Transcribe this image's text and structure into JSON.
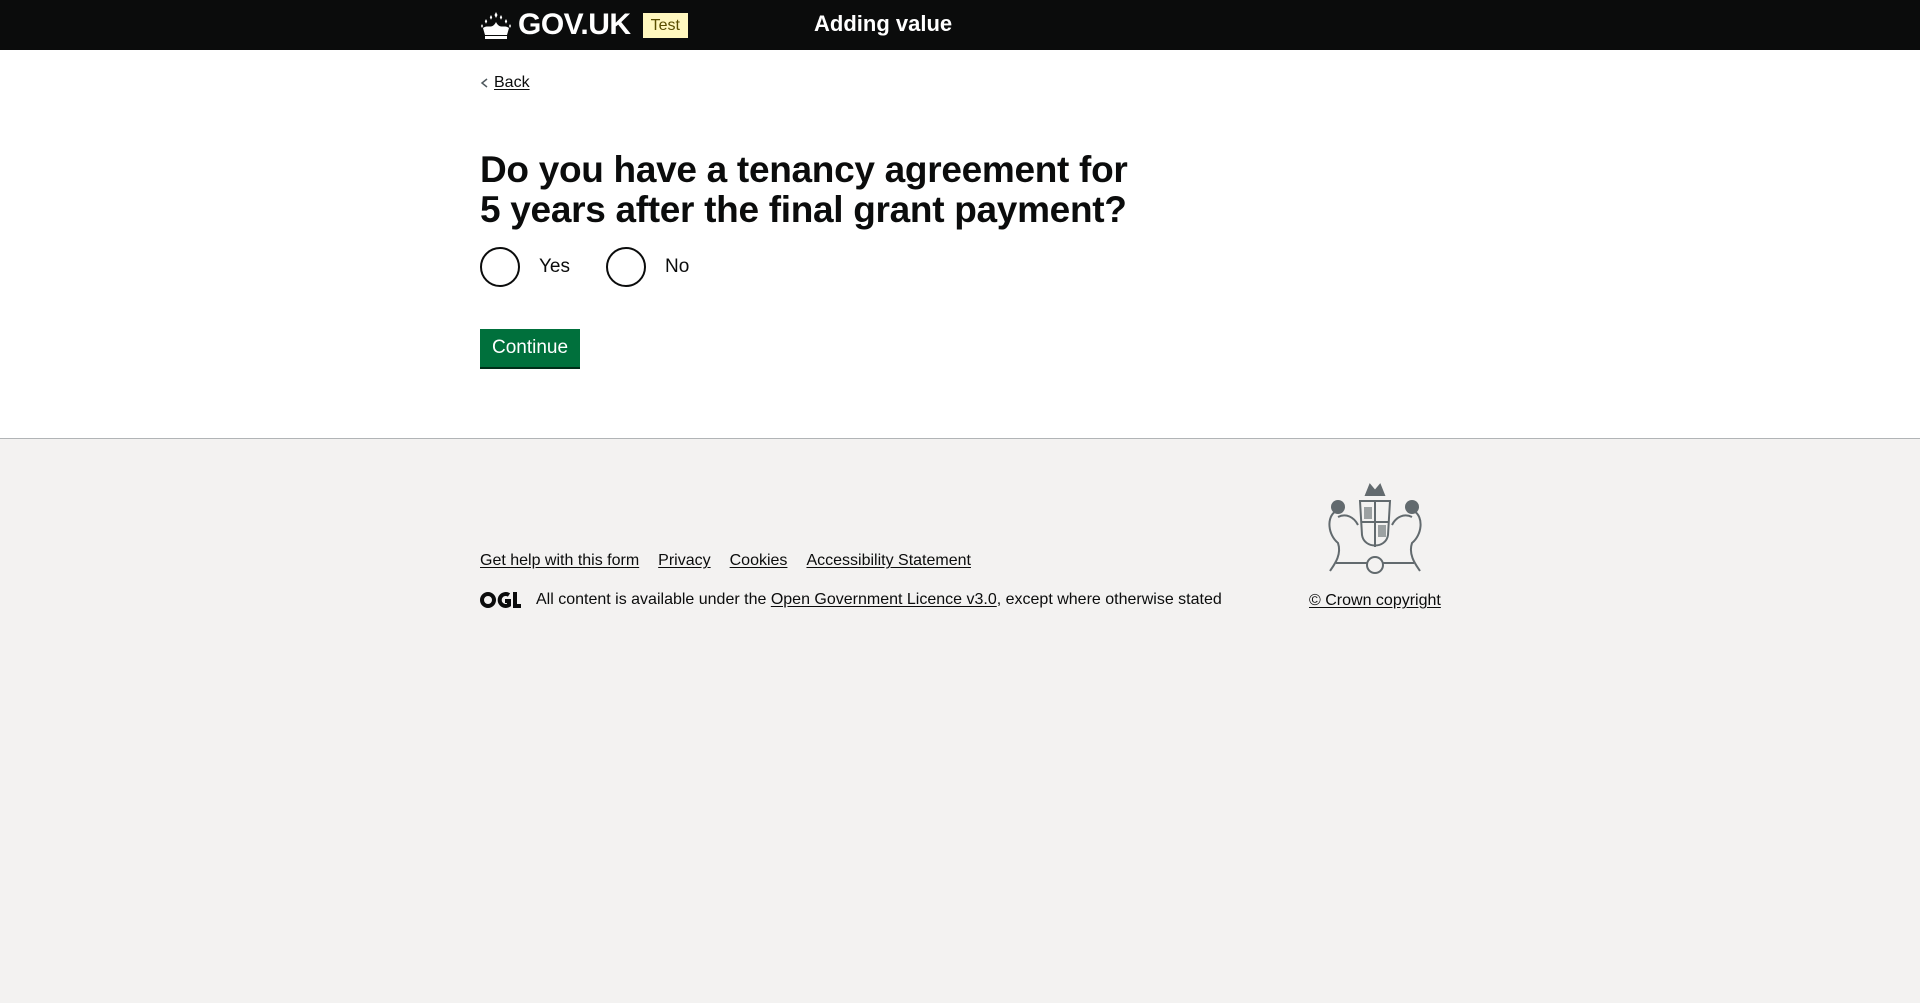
{
  "header": {
    "logo_text": "GOV.UK",
    "phase_tag": "Test",
    "service_name": "Adding value"
  },
  "main": {
    "back_label": "Back",
    "question": "Do you have a tenancy agreement for 5 years after the final grant payment?",
    "options": [
      "Yes",
      "No"
    ],
    "continue_label": "Continue"
  },
  "footer": {
    "links": [
      "Get help with this form",
      "Privacy",
      "Cookies",
      "Accessibility Statement"
    ],
    "licence_prefix": "All content is available under the",
    "licence_link": "Open Government Licence v3.0",
    "licence_suffix": ", except where otherwise stated",
    "copyright": "© Crown copyright"
  },
  "colors": {
    "header_bg": "#0b0c0c",
    "accent_bar": "#1d70b8",
    "button_green": "#00703c",
    "footer_bg": "#f3f2f1",
    "tag_bg": "#fff7bf"
  },
  "icons": [
    "crown-icon",
    "chevron-left-icon",
    "ogl-icon",
    "royal-crest-icon"
  ]
}
